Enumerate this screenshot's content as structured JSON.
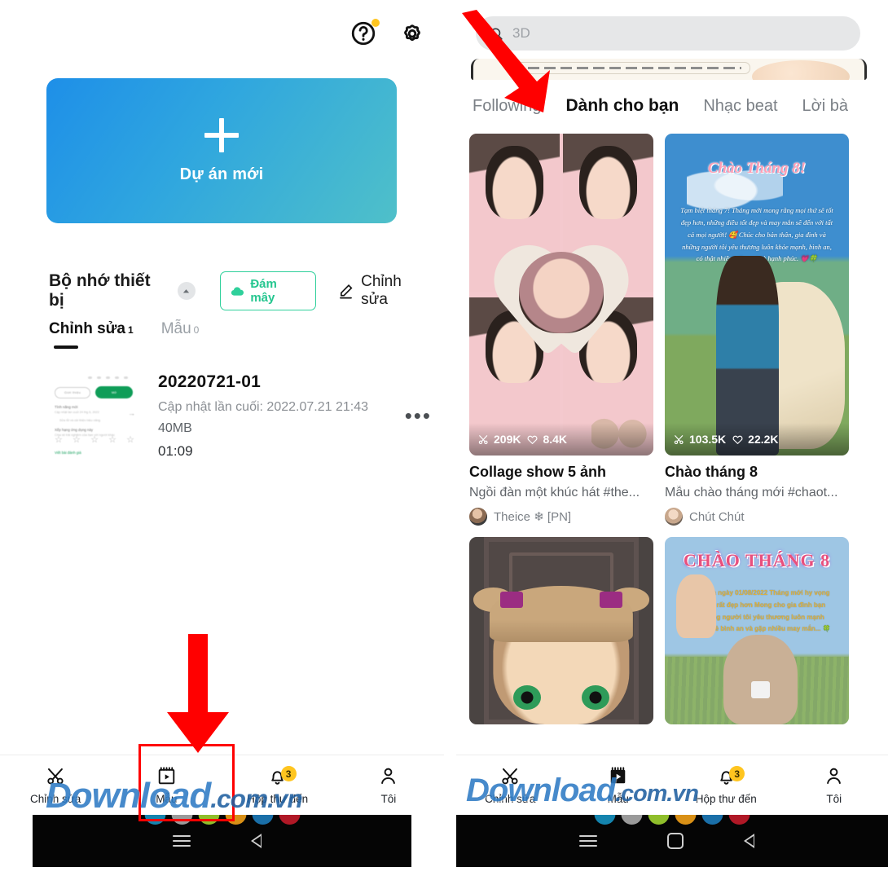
{
  "left_phone": {
    "topbar": {
      "help_icon": "help-circle-icon",
      "settings_icon": "gear-icon",
      "help_badge": true
    },
    "new_project": {
      "label": "Dự án mới",
      "plus_icon": "plus-icon"
    },
    "storage": {
      "title": "Bộ nhớ thiết bị",
      "collapse_icon": "caret-up-icon",
      "cloud_button": {
        "label": "Đám mây",
        "icon": "cloud-icon",
        "color": "#25C68F"
      },
      "edit_button": {
        "label": "Chỉnh sửa",
        "icon": "pencil-icon"
      }
    },
    "segment_tabs": [
      {
        "label": "Chỉnh sửa",
        "count": "1",
        "active": true
      },
      {
        "label": "Mẫu",
        "count": "0",
        "active": false
      }
    ],
    "projects": [
      {
        "title": "20220721-01",
        "updated": "Cập nhật lần cuối: 2022.07.21 21:43",
        "size": "40MB",
        "duration": "01:09",
        "more_icon": "more-horizontal-icon",
        "thumb": {
          "pill_outline": "Giới thiệu",
          "pill_filled": "Mở",
          "row1_title": "Tính năng mới",
          "row1_sub": "Cập nhật lần cuối 24 thg 6, 2022",
          "row1_sub2": "Sửa lỗi và cải thiện hiệu năng",
          "row2_title": "Xếp hạng ứng dụng này",
          "row2_sub": "Chia sẻ trải nghiệm của bạn với người khác",
          "link": "Viết bài đánh giá",
          "stars": 5
        }
      }
    ],
    "bottom_nav": [
      {
        "label": "Chỉnh sửa",
        "icon": "scissors-icon",
        "active": false,
        "badge": null
      },
      {
        "label": "Mẫu",
        "icon": "template-play-icon",
        "active": false,
        "badge": null
      },
      {
        "label": "Hộp thư đến",
        "icon": "bell-icon",
        "active": false,
        "badge": "3"
      },
      {
        "label": "Tôi",
        "icon": "person-icon",
        "active": false,
        "badge": null
      }
    ]
  },
  "right_phone": {
    "search": {
      "placeholder": "3D",
      "icon": "search-icon"
    },
    "feed_tabs": [
      {
        "label": "Following",
        "active": false
      },
      {
        "label": "Dành cho bạn",
        "active": true
      },
      {
        "label": "Nhạc beat",
        "active": false
      },
      {
        "label": "Lời bà",
        "active": false
      }
    ],
    "cards": [
      {
        "title": "Collage show 5 ảnh",
        "desc": "Ngồi đàn một khúc hát #the...",
        "author": "Theice ❄ [PN]",
        "uses": "209K",
        "likes": "8.4K",
        "art": "collage"
      },
      {
        "title": "Chào tháng 8",
        "desc": "Mẫu chào tháng mới #chaot...",
        "author": "Chút Chút",
        "uses": "103.5K",
        "likes": "22.2K",
        "art": "chao8",
        "art_title": "Chào Tháng 8!",
        "art_body": "Tạm biệt tháng 7! Tháng mới mong rằng mọi thứ sẽ tốt đẹp hơn, những điều tốt đẹp và may mắn sẽ đến với tất cả mọi người! 🥰 Chúc cho bản thân, gia đình và những người tôi yêu thương luôn khỏe mạnh, bình an, có thật nhiều niềm vui và hạnh phúc. 💗🍀"
      },
      {
        "title": "",
        "desc": "",
        "author": "",
        "uses": "",
        "likes": "",
        "art": "masha"
      },
      {
        "title": "",
        "desc": "",
        "author": "",
        "uses": "",
        "likes": "",
        "art": "chao8b",
        "art_title": "CHÀO THÁNG 8",
        "art_body": "Hôm nay là ngày 01/08/2022\nTháng mới hy vọng mọi thứ sẽ rất đẹp hơn\nMong cho gia đình bạn bè và những người\ntôi yêu thương luôn mạnh khỏe, vui vẻ bình an và\ngặp nhiều may mắn... 🍀"
      }
    ],
    "bottom_nav": [
      {
        "label": "Chỉnh sửa",
        "icon": "scissors-icon",
        "active": false,
        "badge": null
      },
      {
        "label": "Mẫu",
        "icon": "template-play-filled-icon",
        "active": true,
        "badge": null
      },
      {
        "label": "Hộp thư đến",
        "icon": "bell-icon",
        "active": false,
        "badge": "3"
      },
      {
        "label": "Tôi",
        "icon": "person-icon",
        "active": false,
        "badge": null
      }
    ]
  },
  "android_nav": {
    "menu_icon": "hamburger-icon",
    "home_icon": "home-square-icon",
    "back_icon": "back-triangle-icon",
    "dot_colors": [
      "#1484AE",
      "#9A9A9A",
      "#8FBE2B",
      "#D99016",
      "#1A6FA8",
      "#B01826"
    ]
  },
  "annotations": {
    "arrow_color": "#FF0000",
    "highlight_rect_color": "#FF0000",
    "watermark": {
      "main": "Download",
      "suffix": ".com.vn"
    }
  }
}
